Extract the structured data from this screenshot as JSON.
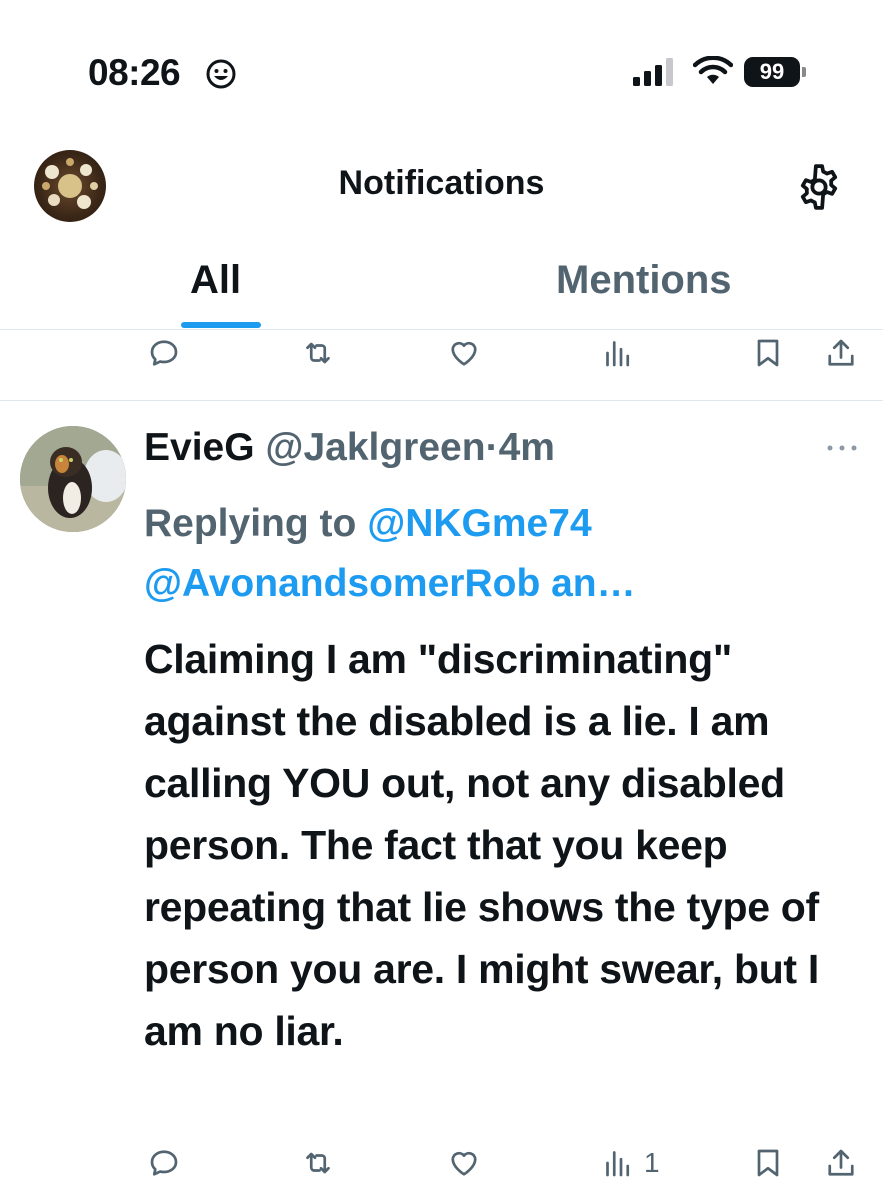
{
  "status_bar": {
    "time": "08:26",
    "battery": "99",
    "icons": [
      "smiley-face-icon",
      "cellular-signal-icon",
      "wifi-icon",
      "battery-icon"
    ]
  },
  "header": {
    "title": "Notifications",
    "tabs": [
      {
        "label": "All",
        "active": true
      },
      {
        "label": "Mentions",
        "active": false
      }
    ],
    "icons": [
      "profile-avatar",
      "settings-gear-icon"
    ]
  },
  "previous_tweet_actions": {
    "icons": [
      "reply-icon",
      "retweet-icon",
      "like-icon",
      "views-icon",
      "bookmark-icon",
      "share-icon"
    ]
  },
  "tweet": {
    "name": "EvieG",
    "handle": "@Jaklgreen",
    "separator": "·",
    "time_ago": "4m",
    "replying_label": "Replying to",
    "replying_mentions": [
      "@NKGme74",
      "@AvonandsomerRob an…"
    ],
    "text": "Claiming I am \"discriminating\" against the disabled is a lie. I am calling YOU out, not any disabled person. The fact that you keep repeating that lie shows the type of person you are. I might swear, but I am no liar.",
    "views_count": "1",
    "icons": [
      "more-options-icon",
      "reply-icon",
      "retweet-icon",
      "like-icon",
      "views-icon",
      "bookmark-icon",
      "share-icon"
    ]
  },
  "colors": {
    "text_primary": "#0f1419",
    "text_secondary": "#536471",
    "accent": "#1d9bf0",
    "divider": "#e1e8ed"
  }
}
